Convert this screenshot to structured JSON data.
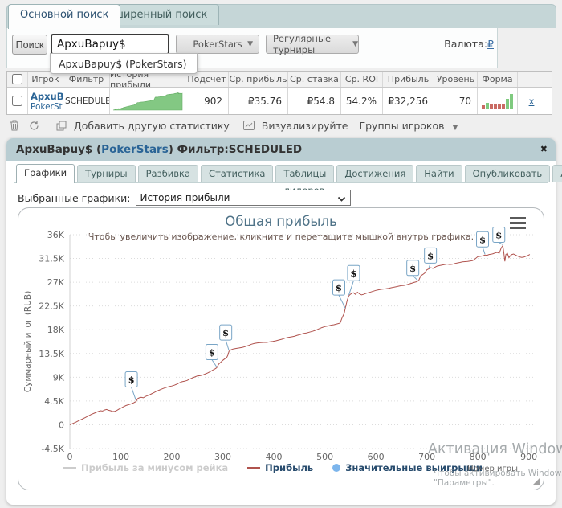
{
  "search": {
    "tabs": [
      {
        "label": "Основной поиск"
      },
      {
        "label": "Расширенный поиск"
      }
    ],
    "button_label": "Поиск",
    "input_value": "ApxuBapuy$",
    "site_select": "PokerStars",
    "tournament_select": "Регулярные турниры",
    "currency_label": "Валюта:",
    "currency_value": "₽",
    "suggestion": "ApxuBapuy$ (PokerStars)"
  },
  "results_table": {
    "columns": [
      "Игрок",
      "Фильтр",
      "История прибыли",
      "Подсчет",
      "Ср. прибыль",
      "Ср. ставка",
      "Ср. ROI",
      "Прибыль",
      "Уровень",
      "Форма"
    ],
    "row": {
      "player_name": "ApxuBapuy$",
      "player_site": "PokerStars",
      "filter": "SCHEDULED",
      "count": "902",
      "avg_profit": "₽35.76",
      "avg_stake": "₽54.8",
      "avg_roi": "54.2%",
      "profit": "₽32,256",
      "level": "70",
      "remove_label": "x"
    },
    "form_bars": [
      {
        "color": "#c96a63",
        "h": 4
      },
      {
        "color": "#7fca7f",
        "h": 7
      },
      {
        "color": "#c96a63",
        "h": 6
      },
      {
        "color": "#c96a63",
        "h": 6
      },
      {
        "color": "#c96a63",
        "h": 6
      },
      {
        "color": "#c96a63",
        "h": 6
      },
      {
        "color": "#7fca7f",
        "h": 12
      },
      {
        "color": "#7fca7f",
        "h": 18
      }
    ],
    "sparkline_color": "#83c883"
  },
  "toolbar": {
    "add_stat_label": "Добавить другую статистику",
    "visualize_label": "Визуализируйте",
    "groups_label": "Группы игроков"
  },
  "panel": {
    "title": {
      "pre": "ApxuBapuy$ (",
      "site": "PokerStars",
      "post": ") Фильтр:SCHEDULED"
    },
    "close_glyph": "✖",
    "tabs": [
      "Графики",
      "Турниры",
      "Разбивка",
      "Статистика",
      "Таблицы лидеров",
      "Достижения",
      "Найти",
      "Опубликовать",
      "Аналитика"
    ],
    "select_label": "Выбранные графики:",
    "select_value": "История прибыли"
  },
  "chart_data": {
    "type": "line",
    "title": "Общая прибыль",
    "subtitle": "Чтобы увеличить изображение, кликните и перетащите мышкой внутрь графика.",
    "ylabel": "Суммарный итог (RUB)",
    "xlabel": "Номер игры",
    "y_ticks": [
      {
        "label": "36K",
        "v": 36000
      },
      {
        "label": "31.5K",
        "v": 31500
      },
      {
        "label": "27K",
        "v": 27000
      },
      {
        "label": "22.5K",
        "v": 22500
      },
      {
        "label": "18K",
        "v": 18000
      },
      {
        "label": "13.5K",
        "v": 13500
      },
      {
        "label": "9K",
        "v": 9000
      },
      {
        "label": "4.5K",
        "v": 4500
      },
      {
        "label": "0",
        "v": 0
      },
      {
        "label": "-4.5K",
        "v": -4500
      }
    ],
    "x_ticks": [
      0,
      100,
      200,
      300,
      400,
      500,
      600,
      700,
      800,
      900
    ],
    "ylim": [
      -4500,
      36000
    ],
    "xlim": [
      0,
      910
    ],
    "grid": "dotted-horizontal",
    "legend_position": "bottom-center",
    "legend": [
      {
        "label": "Прибыль за минусом рейка",
        "type": "line",
        "color": "#cccccc",
        "disabled": true
      },
      {
        "label": "Прибыль",
        "type": "line",
        "color": "#b0534e",
        "disabled": false
      },
      {
        "label": "Значительные выигрыши",
        "type": "marker",
        "color": "#7cb5ec",
        "disabled": false
      }
    ],
    "series": [
      {
        "name": "Прибыль",
        "color": "#b0534e",
        "points": [
          [
            0,
            0
          ],
          [
            6,
            250
          ],
          [
            12,
            500
          ],
          [
            18,
            800
          ],
          [
            24,
            1050
          ],
          [
            30,
            1350
          ],
          [
            36,
            1650
          ],
          [
            42,
            1950
          ],
          [
            48,
            2200
          ],
          [
            54,
            2450
          ],
          [
            60,
            2650
          ],
          [
            64,
            2600
          ],
          [
            68,
            2800
          ],
          [
            72,
            2900
          ],
          [
            76,
            2750
          ],
          [
            80,
            2650
          ],
          [
            84,
            2500
          ],
          [
            88,
            2550
          ],
          [
            92,
            2700
          ],
          [
            96,
            2950
          ],
          [
            100,
            3150
          ],
          [
            105,
            3400
          ],
          [
            110,
            3650
          ],
          [
            115,
            3800
          ],
          [
            120,
            3950
          ],
          [
            125,
            4150
          ],
          [
            130,
            4400
          ],
          [
            133,
            4950
          ],
          [
            136,
            5100
          ],
          [
            140,
            5200
          ],
          [
            144,
            5100
          ],
          [
            148,
            5350
          ],
          [
            152,
            5500
          ],
          [
            156,
            5650
          ],
          [
            160,
            5850
          ],
          [
            165,
            6100
          ],
          [
            170,
            6350
          ],
          [
            175,
            6550
          ],
          [
            180,
            6750
          ],
          [
            185,
            6950
          ],
          [
            190,
            7100
          ],
          [
            195,
            7250
          ],
          [
            200,
            7350
          ],
          [
            205,
            7500
          ],
          [
            210,
            7700
          ],
          [
            215,
            7950
          ],
          [
            220,
            8150
          ],
          [
            225,
            8250
          ],
          [
            230,
            8400
          ],
          [
            235,
            8650
          ],
          [
            240,
            8850
          ],
          [
            245,
            9050
          ],
          [
            250,
            9250
          ],
          [
            255,
            9300
          ],
          [
            260,
            9400
          ],
          [
            265,
            9600
          ],
          [
            270,
            9800
          ],
          [
            275,
            10050
          ],
          [
            280,
            10350
          ],
          [
            285,
            10600
          ],
          [
            288,
            10800
          ],
          [
            292,
            11500
          ],
          [
            296,
            11850
          ],
          [
            300,
            12200
          ],
          [
            304,
            12500
          ],
          [
            308,
            12800
          ],
          [
            310,
            13200
          ],
          [
            312,
            13900
          ],
          [
            316,
            14200
          ],
          [
            320,
            14350
          ],
          [
            326,
            14450
          ],
          [
            332,
            14550
          ],
          [
            338,
            14650
          ],
          [
            344,
            14800
          ],
          [
            350,
            15000
          ],
          [
            356,
            15250
          ],
          [
            362,
            15400
          ],
          [
            368,
            15500
          ],
          [
            374,
            15550
          ],
          [
            380,
            15600
          ],
          [
            386,
            15600
          ],
          [
            392,
            15700
          ],
          [
            398,
            15800
          ],
          [
            404,
            15900
          ],
          [
            410,
            16050
          ],
          [
            416,
            16200
          ],
          [
            422,
            16400
          ],
          [
            428,
            16550
          ],
          [
            434,
            16650
          ],
          [
            440,
            16750
          ],
          [
            446,
            16950
          ],
          [
            452,
            17100
          ],
          [
            458,
            17300
          ],
          [
            464,
            17400
          ],
          [
            470,
            17550
          ],
          [
            476,
            17700
          ],
          [
            482,
            17900
          ],
          [
            488,
            18150
          ],
          [
            494,
            18400
          ],
          [
            500,
            18600
          ],
          [
            506,
            18700
          ],
          [
            512,
            18850
          ],
          [
            518,
            18950
          ],
          [
            524,
            19100
          ],
          [
            530,
            19250
          ],
          [
            534,
            20300
          ],
          [
            538,
            21100
          ],
          [
            541,
            22400
          ],
          [
            544,
            23600
          ],
          [
            547,
            24400
          ],
          [
            550,
            24700
          ],
          [
            553,
            24900
          ],
          [
            556,
            25000
          ],
          [
            560,
            24700
          ],
          [
            564,
            25100
          ],
          [
            568,
            24800
          ],
          [
            572,
            24600
          ],
          [
            576,
            24700
          ],
          [
            580,
            24850
          ],
          [
            585,
            25000
          ],
          [
            590,
            25150
          ],
          [
            595,
            25300
          ],
          [
            600,
            25450
          ],
          [
            605,
            25550
          ],
          [
            610,
            25650
          ],
          [
            615,
            25700
          ],
          [
            620,
            25750
          ],
          [
            625,
            25850
          ],
          [
            630,
            25950
          ],
          [
            635,
            26050
          ],
          [
            640,
            26150
          ],
          [
            645,
            26250
          ],
          [
            650,
            26350
          ],
          [
            655,
            26400
          ],
          [
            660,
            26500
          ],
          [
            665,
            26650
          ],
          [
            670,
            26800
          ],
          [
            675,
            26950
          ],
          [
            680,
            27100
          ],
          [
            684,
            27300
          ],
          [
            688,
            28200
          ],
          [
            692,
            28450
          ],
          [
            696,
            28750
          ],
          [
            700,
            29350
          ],
          [
            704,
            29550
          ],
          [
            708,
            29750
          ],
          [
            712,
            29600
          ],
          [
            716,
            29850
          ],
          [
            720,
            30050
          ],
          [
            725,
            30150
          ],
          [
            730,
            30250
          ],
          [
            735,
            30350
          ],
          [
            740,
            30450
          ],
          [
            745,
            30350
          ],
          [
            750,
            30400
          ],
          [
            755,
            30550
          ],
          [
            760,
            30650
          ],
          [
            765,
            30750
          ],
          [
            770,
            30850
          ],
          [
            775,
            30900
          ],
          [
            780,
            30950
          ],
          [
            785,
            31000
          ],
          [
            790,
            31100
          ],
          [
            795,
            31450
          ],
          [
            800,
            31850
          ],
          [
            805,
            31900
          ],
          [
            810,
            32000
          ],
          [
            814,
            32150
          ],
          [
            818,
            32100
          ],
          [
            822,
            32250
          ],
          [
            826,
            32300
          ],
          [
            830,
            32400
          ],
          [
            834,
            32550
          ],
          [
            838,
            32650
          ],
          [
            842,
            32500
          ],
          [
            846,
            33500
          ],
          [
            849,
            33950
          ],
          [
            851,
            32600
          ],
          [
            853,
            30950
          ],
          [
            855,
            32250
          ],
          [
            858,
            32450
          ],
          [
            861,
            31650
          ],
          [
            864,
            32050
          ],
          [
            867,
            32250
          ],
          [
            870,
            32350
          ],
          [
            874,
            32150
          ],
          [
            878,
            31950
          ],
          [
            882,
            31800
          ],
          [
            886,
            31700
          ],
          [
            890,
            31750
          ],
          [
            894,
            31900
          ],
          [
            898,
            32050
          ],
          [
            902,
            32256
          ]
        ]
      }
    ],
    "markers": [
      {
        "g": 130,
        "lift": 18,
        "dx": -6
      },
      {
        "g": 288,
        "lift": 10,
        "dx": -6
      },
      {
        "g": 312,
        "lift": 14,
        "dx": -4
      },
      {
        "g": 540,
        "lift": 17,
        "dx": -8
      },
      {
        "g": 547,
        "lift": 19,
        "dx": 6
      },
      {
        "g": 682,
        "lift": 7,
        "dx": -6
      },
      {
        "g": 704,
        "lift": 7,
        "dx": 2
      },
      {
        "g": 814,
        "lift": 10,
        "dx": -3
      },
      {
        "g": 849,
        "lift": 4,
        "dx": -5
      }
    ],
    "marker_glyph": "$",
    "marker_border_color": "#79a5c6"
  },
  "watermark": {
    "line1": "Активация Windows",
    "line2": "Чтобы активировать Windows, перейдите в раздел",
    "line3": "\"Параметры\"."
  }
}
